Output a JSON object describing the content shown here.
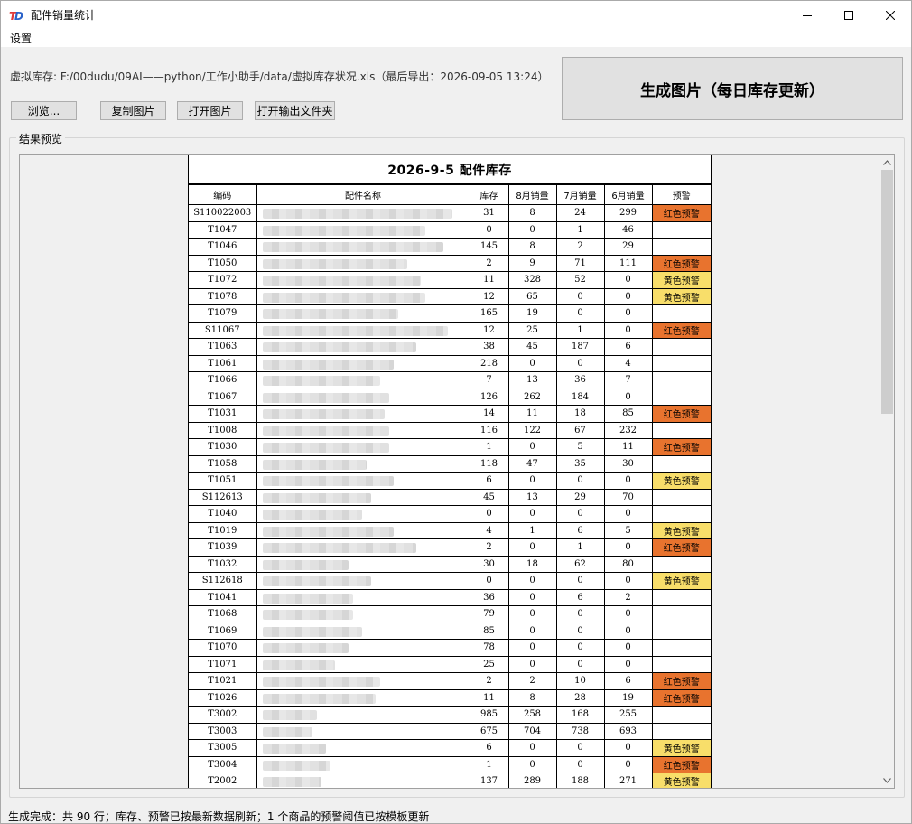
{
  "window": {
    "title": "配件销量统计"
  },
  "menu": {
    "settings": "设置"
  },
  "path_label": "虚拟库存: F:/00dudu/09AI——python/工作小助手/data/虚拟库存状况.xls（最后导出：2026-09-05 13:24）",
  "buttons": {
    "browse": "浏览...",
    "copy_image": "复制图片",
    "open_image": "打开图片",
    "open_folder": "打开输出文件夹",
    "generate": "生成图片（每日库存更新）"
  },
  "preview_label": "结果预览",
  "report": {
    "title": "2026-9-5  配件库存",
    "headers": [
      "编码",
      "配件名称",
      "库存",
      "8月销量",
      "7月销量",
      "6月销量",
      "预警"
    ],
    "rows": [
      {
        "code": "S110022003",
        "stock": "31",
        "aug": "8",
        "jul": "24",
        "jun": "299",
        "warn": "红色预警",
        "level": "red",
        "w": 210
      },
      {
        "code": "T1047",
        "stock": "0",
        "aug": "0",
        "jul": "1",
        "jun": "46",
        "warn": "",
        "level": "",
        "w": 180
      },
      {
        "code": "T1046",
        "stock": "145",
        "aug": "8",
        "jul": "2",
        "jun": "29",
        "warn": "",
        "level": "",
        "w": 200
      },
      {
        "code": "T1050",
        "stock": "2",
        "aug": "9",
        "jul": "71",
        "jun": "111",
        "warn": "红色预警",
        "level": "red",
        "w": 160
      },
      {
        "code": "T1072",
        "stock": "11",
        "aug": "328",
        "jul": "52",
        "jun": "0",
        "warn": "黄色预警",
        "level": "yellow",
        "w": 175
      },
      {
        "code": "T1078",
        "stock": "12",
        "aug": "65",
        "jul": "0",
        "jun": "0",
        "warn": "黄色预警",
        "level": "yellow",
        "w": 180
      },
      {
        "code": "T1079",
        "stock": "165",
        "aug": "19",
        "jul": "0",
        "jun": "0",
        "warn": "",
        "level": "",
        "w": 150
      },
      {
        "code": "S11067",
        "stock": "12",
        "aug": "25",
        "jul": "1",
        "jun": "0",
        "warn": "红色预警",
        "level": "red",
        "w": 205
      },
      {
        "code": "T1063",
        "stock": "38",
        "aug": "45",
        "jul": "187",
        "jun": "6",
        "warn": "",
        "level": "",
        "w": 170
      },
      {
        "code": "T1061",
        "stock": "218",
        "aug": "0",
        "jul": "0",
        "jun": "4",
        "warn": "",
        "level": "",
        "w": 145
      },
      {
        "code": "T1066",
        "stock": "7",
        "aug": "13",
        "jul": "36",
        "jun": "7",
        "warn": "",
        "level": "",
        "w": 130
      },
      {
        "code": "T1067",
        "stock": "126",
        "aug": "262",
        "jul": "184",
        "jun": "0",
        "warn": "",
        "level": "",
        "w": 140
      },
      {
        "code": "T1031",
        "stock": "14",
        "aug": "11",
        "jul": "18",
        "jun": "85",
        "warn": "红色预警",
        "level": "red",
        "w": 135
      },
      {
        "code": "T1008",
        "stock": "116",
        "aug": "122",
        "jul": "67",
        "jun": "232",
        "warn": "",
        "level": "",
        "w": 140
      },
      {
        "code": "T1030",
        "stock": "1",
        "aug": "0",
        "jul": "5",
        "jun": "11",
        "warn": "红色预警",
        "level": "red",
        "w": 140
      },
      {
        "code": "T1058",
        "stock": "118",
        "aug": "47",
        "jul": "35",
        "jun": "30",
        "warn": "",
        "level": "",
        "w": 115
      },
      {
        "code": "T1051",
        "stock": "6",
        "aug": "0",
        "jul": "0",
        "jun": "0",
        "warn": "黄色预警",
        "level": "yellow",
        "w": 145
      },
      {
        "code": "S112613",
        "stock": "45",
        "aug": "13",
        "jul": "29",
        "jun": "70",
        "warn": "",
        "level": "",
        "w": 120
      },
      {
        "code": "T1040",
        "stock": "0",
        "aug": "0",
        "jul": "0",
        "jun": "0",
        "warn": "",
        "level": "",
        "w": 110
      },
      {
        "code": "T1019",
        "stock": "4",
        "aug": "1",
        "jul": "6",
        "jun": "5",
        "warn": "黄色预警",
        "level": "yellow",
        "w": 145
      },
      {
        "code": "T1039",
        "stock": "2",
        "aug": "0",
        "jul": "1",
        "jun": "0",
        "warn": "红色预警",
        "level": "red",
        "w": 170
      },
      {
        "code": "T1032",
        "stock": "30",
        "aug": "18",
        "jul": "62",
        "jun": "80",
        "warn": "",
        "level": "",
        "w": 95
      },
      {
        "code": "S112618",
        "stock": "0",
        "aug": "0",
        "jul": "0",
        "jun": "0",
        "warn": "黄色预警",
        "level": "yellow",
        "w": 120
      },
      {
        "code": "T1041",
        "stock": "36",
        "aug": "0",
        "jul": "6",
        "jun": "2",
        "warn": "",
        "level": "",
        "w": 100
      },
      {
        "code": "T1068",
        "stock": "79",
        "aug": "0",
        "jul": "0",
        "jun": "0",
        "warn": "",
        "level": "",
        "w": 100
      },
      {
        "code": "T1069",
        "stock": "85",
        "aug": "0",
        "jul": "0",
        "jun": "0",
        "warn": "",
        "level": "",
        "w": 110
      },
      {
        "code": "T1070",
        "stock": "78",
        "aug": "0",
        "jul": "0",
        "jun": "0",
        "warn": "",
        "level": "",
        "w": 95
      },
      {
        "code": "T1071",
        "stock": "25",
        "aug": "0",
        "jul": "0",
        "jun": "0",
        "warn": "",
        "level": "",
        "w": 80
      },
      {
        "code": "T1021",
        "stock": "2",
        "aug": "2",
        "jul": "10",
        "jun": "6",
        "warn": "红色预警",
        "level": "red",
        "w": 130
      },
      {
        "code": "T1026",
        "stock": "11",
        "aug": "8",
        "jul": "28",
        "jun": "19",
        "warn": "红色预警",
        "level": "red",
        "w": 125
      },
      {
        "code": "T3002",
        "stock": "985",
        "aug": "258",
        "jul": "168",
        "jun": "255",
        "warn": "",
        "level": "",
        "w": 60
      },
      {
        "code": "T3003",
        "stock": "675",
        "aug": "704",
        "jul": "738",
        "jun": "693",
        "warn": "",
        "level": "",
        "w": 55
      },
      {
        "code": "T3005",
        "stock": "6",
        "aug": "0",
        "jul": "0",
        "jun": "0",
        "warn": "黄色预警",
        "level": "yellow",
        "w": 70
      },
      {
        "code": "T3004",
        "stock": "1",
        "aug": "0",
        "jul": "0",
        "jun": "0",
        "warn": "红色预警",
        "level": "red",
        "w": 75
      },
      {
        "code": "T2002",
        "stock": "137",
        "aug": "289",
        "jul": "188",
        "jun": "271",
        "warn": "黄色预警",
        "level": "yellow",
        "w": 65
      }
    ]
  },
  "status": "生成完成：共 90 行；库存、预警已按最新数据刷新；1 个商品的预警阈值已按模板更新",
  "colors": {
    "red_warn": "#e8732e",
    "yellow_warn": "#f8de6a",
    "accent_icon": "#e03a3a"
  }
}
